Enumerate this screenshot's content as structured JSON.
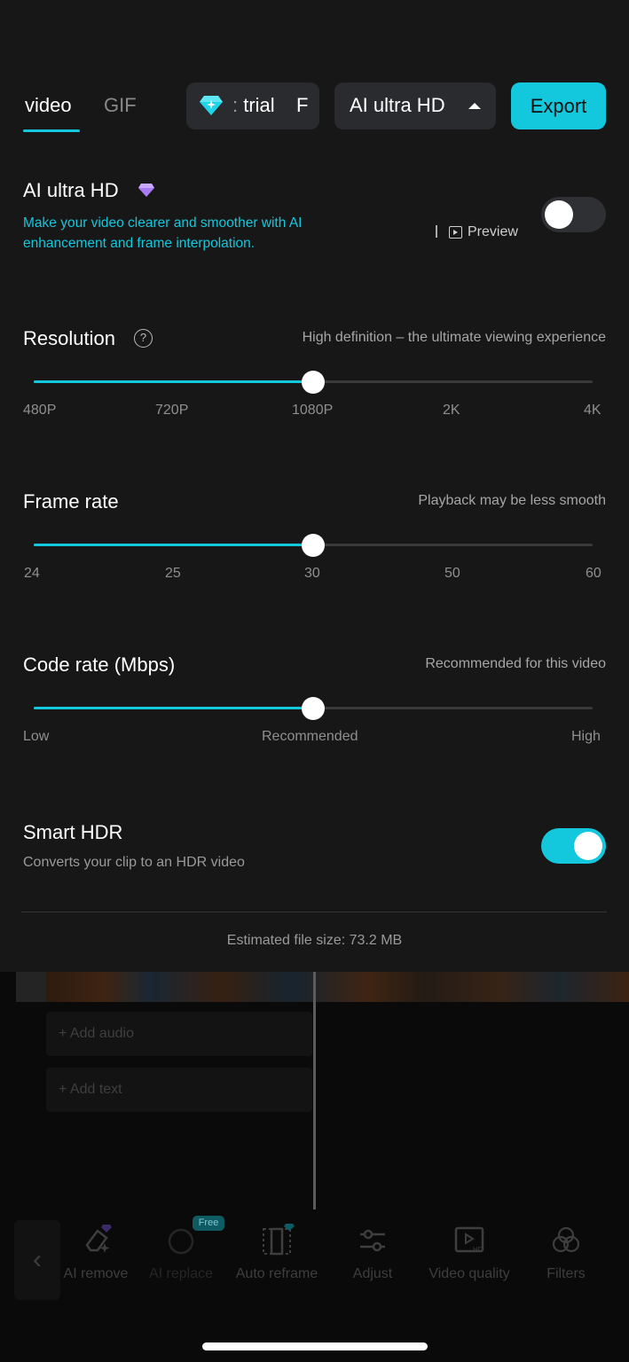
{
  "tabs": [
    {
      "label": "video",
      "active": true
    },
    {
      "label": "GIF",
      "active": false
    }
  ],
  "header": {
    "trial_label": "trial",
    "trial_trailing": "F",
    "quality_label": "AI ultra HD",
    "export_label": "Export"
  },
  "ai_ultra_hd": {
    "title": "AI ultra HD",
    "description": "Make your video clearer and smoother with AI enhancement and frame interpolation.",
    "separator": "I",
    "preview_label": "Preview",
    "enabled": false
  },
  "resolution": {
    "title": "Resolution",
    "hint": "High definition – the ultimate viewing experience",
    "ticks": [
      "480P",
      "720P",
      "1080P",
      "2K",
      "4K"
    ],
    "selected": "1080P",
    "position_fraction": 0.5
  },
  "frame_rate": {
    "title": "Frame rate",
    "hint": "Playback may be less smooth",
    "ticks": [
      "24",
      "25",
      "30",
      "50",
      "60"
    ],
    "selected": "30",
    "position_fraction": 0.5
  },
  "code_rate": {
    "title": "Code rate (Mbps)",
    "hint": "Recommended for this video",
    "ticks": [
      "Low",
      "Recommended",
      "High"
    ],
    "selected": "Recommended",
    "position_fraction": 0.5
  },
  "smart_hdr": {
    "title": "Smart HDR",
    "description": "Converts your clip to an HDR video",
    "enabled": true
  },
  "file_size_text": "Estimated file size: 73.2 MB",
  "editor": {
    "add_audio": "Add audio",
    "add_text": "Add text",
    "back_glyph": "‹",
    "free_badge": "Free",
    "tools": [
      {
        "label": "AI remove"
      },
      {
        "label": "AI replace"
      },
      {
        "label": "Auto reframe"
      },
      {
        "label": "Adjust"
      },
      {
        "label": "Video quality"
      },
      {
        "label": "Filters"
      }
    ]
  },
  "colors": {
    "accent": "#13c7dc",
    "panel_bg": "#171717",
    "pill_bg": "#2a2b2e"
  }
}
